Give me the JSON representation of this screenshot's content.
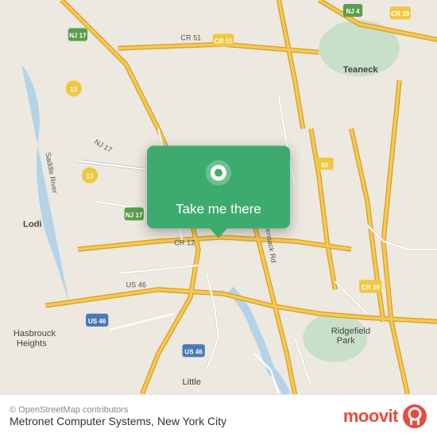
{
  "map": {
    "attribution": "© OpenStreetMap contributors",
    "background_color": "#e8e0d5"
  },
  "card": {
    "take_me_label": "Take me there"
  },
  "bottom_bar": {
    "location_name": "Metronet Computer Systems, New York City",
    "moovit_brand": "moovit"
  },
  "labels": {
    "teaneck": "Teaneck",
    "lodi": "Lodi",
    "hasbrouck_heights": "Hasbrouck\nHeights",
    "ridgefield_park": "Ridgefield\nPark",
    "little": "Little",
    "hackensack_rd": "Hackensack Rd",
    "cr_12": "CR 12",
    "us_46": "US 46",
    "nj_17": "NJ 17",
    "saddle_river": "Saddle River"
  },
  "shields": [
    {
      "id": "cr10",
      "label": "CR 10"
    },
    {
      "id": "cr51",
      "label": "CR 51"
    },
    {
      "id": "nj17a",
      "label": "NJ 17"
    },
    {
      "id": "nj17b",
      "label": "NJ 17"
    },
    {
      "id": "cr13a",
      "label": "13"
    },
    {
      "id": "cr13b",
      "label": "13"
    },
    {
      "id": "cr60",
      "label": "60"
    },
    {
      "id": "cr39",
      "label": "CR 39"
    },
    {
      "id": "nj4",
      "label": "NJ 4"
    },
    {
      "id": "us46",
      "label": "US 46"
    }
  ],
  "icons": {
    "pin": "location-pin-icon",
    "moovit_logo_icon": "moovit-logo-icon"
  }
}
